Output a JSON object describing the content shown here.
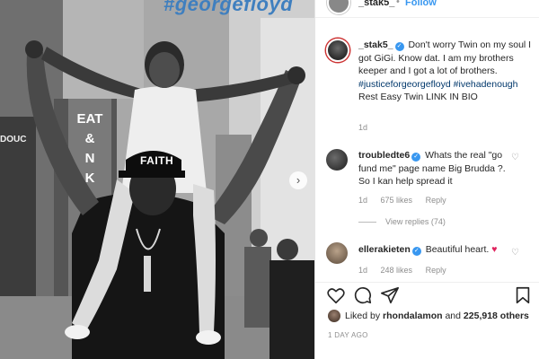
{
  "photo": {
    "hashtag": "#georgefloyd",
    "store_sign": [
      "EAT",
      "&",
      "N",
      "K"
    ],
    "left_sign": "DOUC",
    "cap_text": "FAITH",
    "next_arrow": "›"
  },
  "header": {
    "username": "_stak5_",
    "dot": "•",
    "follow_label": "Follow"
  },
  "caption": {
    "username": "_stak5_",
    "text_1": "Don't worry Twin on my soul I got GiGi. Know dat. I am my brothers keeper and I got a lot of brothers.",
    "hashtag_1": "#justiceforgeorgefloyd",
    "hashtag_2": "#ivehadenough",
    "text_2": "Rest Easy Twin LINK IN BIO",
    "time": "1d"
  },
  "comments": [
    {
      "username": "troubledte6",
      "text": "Whats the real \"go fund me\" page name Big Brudda ?. So I kan help spread it",
      "time": "1d",
      "likes": "675 likes",
      "reply_label": "Reply",
      "view_replies": "View replies (74)"
    },
    {
      "username": "ellerakieten",
      "text": "Beautiful heart.",
      "time": "1d",
      "likes": "248 likes",
      "reply_label": "Reply"
    }
  ],
  "likes": {
    "prefix": "Liked by",
    "user": "rhondalamon",
    "and": "and",
    "count": "225,918 others"
  },
  "posted_ago": "1 DAY AGO",
  "colors": {
    "link": "#00376b",
    "follow": "#3897f0",
    "heart": "#e0245e"
  }
}
